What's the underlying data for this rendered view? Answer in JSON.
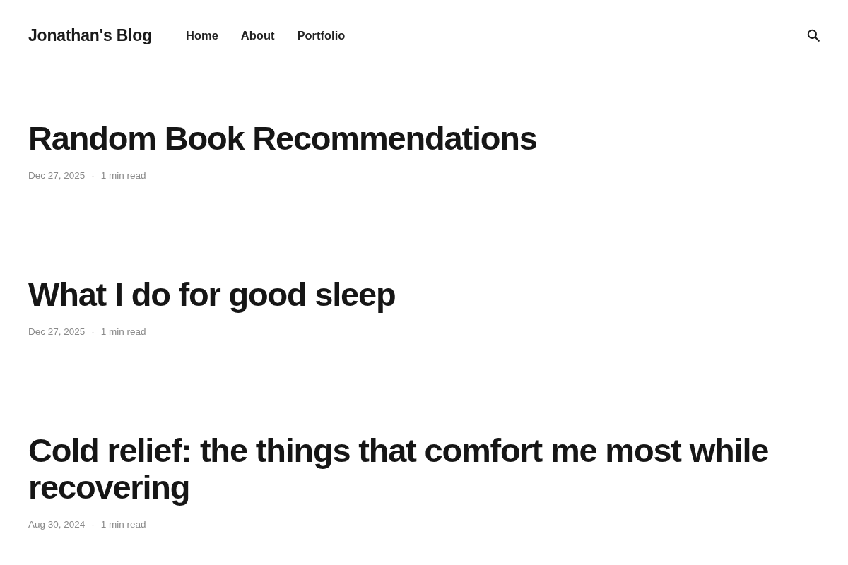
{
  "header": {
    "logo": "Jonathan's Blog",
    "nav": [
      {
        "label": "Home"
      },
      {
        "label": "About"
      },
      {
        "label": "Portfolio"
      }
    ]
  },
  "posts": [
    {
      "title": "Random Book Recommendations",
      "date": "Dec 27, 2025",
      "separator": "·",
      "read_time": "1 min read"
    },
    {
      "title": "What I do for good sleep",
      "date": "Dec 27, 2025",
      "separator": "·",
      "read_time": "1 min read"
    },
    {
      "title": "Cold relief: the things that comfort me most while recovering",
      "date": "Aug 30, 2024",
      "separator": "·",
      "read_time": "1 min read"
    }
  ]
}
